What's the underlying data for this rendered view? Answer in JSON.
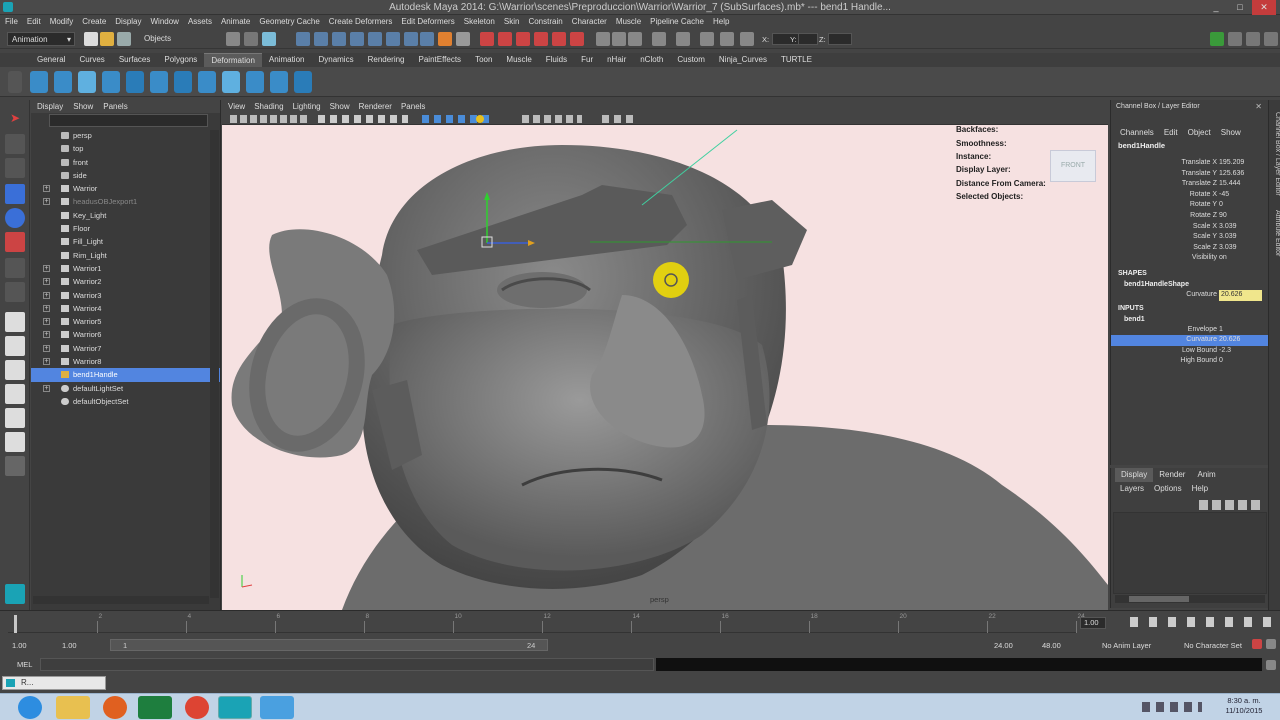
{
  "window": {
    "title": "Autodesk Maya 2014: G:\\Warrior\\scenes\\Preproduccion\\Warrior\\Warrior_7 (SubSurfaces).mb*   ---   bend1 Handle...",
    "minimize": "_",
    "maximize": "□",
    "close": "✕"
  },
  "menubar": [
    "File",
    "Edit",
    "Modify",
    "Create",
    "Display",
    "Window",
    "Assets",
    "Animate",
    "Geometry Cache",
    "Create Deformers",
    "Edit Deformers",
    "Skeleton",
    "Skin",
    "Constrain",
    "Character",
    "Muscle",
    "Pipeline Cache",
    "Help"
  ],
  "statusline": {
    "menuset": "Animation",
    "objects_label": "Objects",
    "x_label": "X:",
    "y_label": "Y:",
    "z_label": "Z:"
  },
  "shelf_tabs": [
    "General",
    "Curves",
    "Surfaces",
    "Polygons",
    "Deformation",
    "Animation",
    "Dynamics",
    "Rendering",
    "PaintEffects",
    "Toon",
    "Muscle",
    "Fluids",
    "Fur",
    "nHair",
    "nCloth",
    "Custom",
    "Ninja_Curves",
    "TURTLE"
  ],
  "shelf_active_tab": "Deformation",
  "outliner": {
    "menu": [
      "Display",
      "Show",
      "Panels"
    ],
    "items": [
      {
        "label": "persp",
        "type": "camera",
        "expand": false,
        "sel": false,
        "dim": false
      },
      {
        "label": "top",
        "type": "camera",
        "expand": false,
        "sel": false,
        "dim": false
      },
      {
        "label": "front",
        "type": "camera",
        "expand": false,
        "sel": false,
        "dim": false
      },
      {
        "label": "side",
        "type": "camera",
        "expand": false,
        "sel": false,
        "dim": false
      },
      {
        "label": "Warrior",
        "type": "transform",
        "expand": true,
        "sel": false,
        "dim": false
      },
      {
        "label": "headusOBJexport1",
        "type": "transform",
        "expand": true,
        "sel": false,
        "dim": true
      },
      {
        "label": "Key_Light",
        "type": "light",
        "expand": false,
        "sel": false,
        "dim": false
      },
      {
        "label": "Floor",
        "type": "light",
        "expand": false,
        "sel": false,
        "dim": false
      },
      {
        "label": "Fill_Light",
        "type": "light",
        "expand": false,
        "sel": false,
        "dim": false
      },
      {
        "label": "Rim_Light",
        "type": "light",
        "expand": false,
        "sel": false,
        "dim": false
      },
      {
        "label": "Warrior1",
        "type": "transform",
        "expand": true,
        "sel": false,
        "dim": false
      },
      {
        "label": "Warrior2",
        "type": "transform",
        "expand": true,
        "sel": false,
        "dim": false
      },
      {
        "label": "Warrior3",
        "type": "transform",
        "expand": true,
        "sel": false,
        "dim": false
      },
      {
        "label": "Warrior4",
        "type": "transform",
        "expand": true,
        "sel": false,
        "dim": false
      },
      {
        "label": "Warrior5",
        "type": "transform",
        "expand": true,
        "sel": false,
        "dim": false
      },
      {
        "label": "Warrior6",
        "type": "transform",
        "expand": true,
        "sel": false,
        "dim": false
      },
      {
        "label": "Warrior7",
        "type": "transform",
        "expand": true,
        "sel": false,
        "dim": false
      },
      {
        "label": "Warrior8",
        "type": "transform",
        "expand": true,
        "sel": false,
        "dim": false
      },
      {
        "label": "bend1Handle",
        "type": "deformer",
        "expand": false,
        "sel": true,
        "dim": false
      },
      {
        "label": "defaultLightSet",
        "type": "set",
        "expand": true,
        "sel": false,
        "dim": false
      },
      {
        "label": "defaultObjectSet",
        "type": "set",
        "expand": false,
        "sel": false,
        "dim": false
      }
    ]
  },
  "viewport": {
    "menu": [
      "View",
      "Shading",
      "Lighting",
      "Show",
      "Renderer",
      "Panels"
    ],
    "hud": [
      "Backfaces:",
      "Smoothness:",
      "Instance:",
      "Display Layer:",
      "Distance From Camera:",
      "Selected Objects:"
    ],
    "camera_label": "persp",
    "viewcube_label": "FRONT",
    "background": "#f6e1e1"
  },
  "channelbox": {
    "title": "Channel Box / Layer Editor",
    "menu": [
      "Channels",
      "Edit",
      "Object",
      "Show"
    ],
    "object_name": "bend1Handle",
    "attributes": [
      {
        "name": "Translate X",
        "value": "195.209"
      },
      {
        "name": "Translate Y",
        "value": "125.636"
      },
      {
        "name": "Translate Z",
        "value": "15.444"
      },
      {
        "name": "Rotate X",
        "value": "-45"
      },
      {
        "name": "Rotate Y",
        "value": "0"
      },
      {
        "name": "Rotate Z",
        "value": "90"
      },
      {
        "name": "Scale X",
        "value": "3.039"
      },
      {
        "name": "Scale Y",
        "value": "3.039"
      },
      {
        "name": "Scale Z",
        "value": "3.039"
      },
      {
        "name": "Visibility",
        "value": "on"
      }
    ],
    "shapes_header": "SHAPES",
    "shape_name": "bend1HandleShape",
    "shape_attr": {
      "name": "Curvature",
      "value": "20.626"
    },
    "inputs_header": "INPUTS",
    "input_name": "bend1",
    "input_attrs": [
      {
        "name": "Envelope",
        "value": "1",
        "hl": false
      },
      {
        "name": "Curvature",
        "value": "20.626",
        "hl": true
      },
      {
        "name": "Low Bound",
        "value": "-2.3",
        "hl": false
      },
      {
        "name": "High Bound",
        "value": "0",
        "hl": false
      }
    ]
  },
  "layer_editor": {
    "tabs": [
      "Display",
      "Render",
      "Anim"
    ],
    "active_tab": "Display",
    "menu": [
      "Layers",
      "Options",
      "Help"
    ]
  },
  "right_strip_labels": [
    "Channel Box / Layer Editor",
    "Attribute Editor"
  ],
  "timeline": {
    "ticks": [
      "2",
      "4",
      "6",
      "8",
      "10",
      "12",
      "14",
      "16",
      "18",
      "20",
      "22",
      "24"
    ],
    "current_frame": "1.00",
    "start": "1.00",
    "start2": "1.00",
    "range_start": "1",
    "range_end": "24",
    "end": "24.00",
    "end2": "48.00",
    "anim_layer": "No Anim Layer",
    "char_set": "No Character Set"
  },
  "cmdline": {
    "label": "MEL"
  },
  "helpline": {
    "minimized_label": "R..."
  },
  "taskbar": {
    "time": "8:30 a. m.",
    "date": "11/10/2015"
  }
}
